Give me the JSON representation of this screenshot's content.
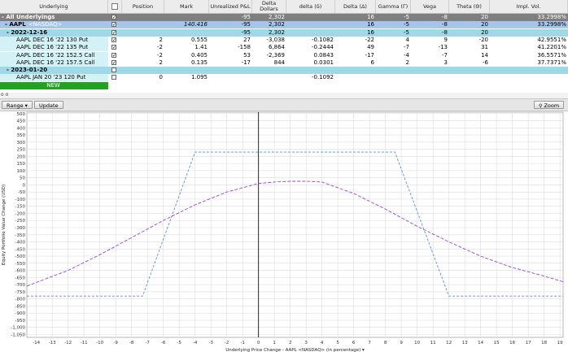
{
  "columns": [
    "Underlying",
    "",
    "Position",
    "Mark",
    "Unrealized P&L",
    "Delta Dollars",
    "delta (δ)",
    "Delta (Δ)",
    "Gamma (Γ)",
    "Vega",
    "Theta (Θ)",
    "Impl. Vol."
  ],
  "rows": [
    {
      "kind": "all",
      "name": "- All Underlyings",
      "checked": true,
      "position": "",
      "mark": "",
      "pnl": "-95",
      "delta_dollars": "2,302",
      "delta_small": "",
      "delta": "16",
      "gamma": "-5",
      "vega": "-8",
      "theta": "20",
      "iv": "33.2998%"
    },
    {
      "kind": "und",
      "name": "- AAPL",
      "exchange": "<NASDAQ>",
      "checked": true,
      "position": "",
      "mark": "140.416",
      "pnl": "-95",
      "delta_dollars": "2,302",
      "delta_small": "",
      "delta": "16",
      "gamma": "-5",
      "vega": "-8",
      "theta": "20",
      "iv": "33.2998%"
    },
    {
      "kind": "exp",
      "name": "- 2022-12-16",
      "checked": true,
      "position": "",
      "mark": "",
      "pnl": "-95",
      "delta_dollars": "2,302",
      "delta_small": "",
      "delta": "16",
      "gamma": "-5",
      "vega": "-8",
      "theta": "20",
      "iv": ""
    },
    {
      "kind": "leg",
      "name": "AAPL DEC 16 '22 130 Put",
      "checked": true,
      "position": "2",
      "mark": "0.555",
      "pnl": "27",
      "delta_dollars": "-3,038",
      "delta_small": "-0.1082",
      "delta": "-22",
      "gamma": "4",
      "vega": "9",
      "theta": "-20",
      "iv": "42.9551%"
    },
    {
      "kind": "leg",
      "name": "AAPL DEC 16 '22 135 Put",
      "checked": true,
      "position": "-2",
      "mark": "1.41",
      "pnl": "-158",
      "delta_dollars": "6,864",
      "delta_small": "-0.2444",
      "delta": "49",
      "gamma": "-7",
      "vega": "-13",
      "theta": "31",
      "iv": "41.2201%"
    },
    {
      "kind": "leg",
      "name": "AAPL DEC 16 '22 152.5 Call",
      "checked": true,
      "position": "-2",
      "mark": "0.405",
      "pnl": "53",
      "delta_dollars": "-2,369",
      "delta_small": "0.0843",
      "delta": "-17",
      "gamma": "-4",
      "vega": "-7",
      "theta": "14",
      "iv": "36.5571%"
    },
    {
      "kind": "leg",
      "name": "AAPL DEC 16 '22 157.5 Call",
      "checked": true,
      "position": "2",
      "mark": "0.135",
      "pnl": "-17",
      "delta_dollars": "844",
      "delta_small": "0.0301",
      "delta": "6",
      "gamma": "2",
      "vega": "3",
      "theta": "-6",
      "iv": "37.7371%"
    },
    {
      "kind": "exp",
      "name": "- 2023-01-20",
      "checked": false,
      "position": "",
      "mark": "",
      "pnl": "",
      "delta_dollars": "",
      "delta_small": "",
      "delta": "",
      "gamma": "",
      "vega": "",
      "theta": "",
      "iv": ""
    },
    {
      "kind": "leg2",
      "name": "AAPL JAN 20 '23 120 Put",
      "checked": false,
      "position": "0",
      "mark": "1.095",
      "pnl": "",
      "delta_dollars": "",
      "delta_small": "-0.1092",
      "delta": "",
      "gamma": "",
      "vega": "",
      "theta": "",
      "iv": ""
    },
    {
      "kind": "new",
      "name": "NEW",
      "checked": false
    }
  ],
  "toolbar": {
    "range_label": "Range ▾",
    "update_label": "Update",
    "zoom_label": "Zoom"
  },
  "colors": {
    "all_row": "#7f7f7f",
    "und_row": "#a8c4e8",
    "exp_row": "#9fd8e6",
    "leg_row": "#d4f2f5",
    "new_row": "#21a321",
    "line_expiry": "#5b8fd4",
    "line_today": "#9b3fe0"
  },
  "chart_data": {
    "type": "line",
    "xlabel": "Underlying Price Change - AAPL <NASDAQ> (in percentage) ▾",
    "ylabel": "Equity Portfolio Value Change (USD)",
    "xlim": [
      -14.6,
      19.2
    ],
    "ylim": [
      -1070,
      510
    ],
    "xticks": [
      -14,
      -13,
      -12,
      -11,
      -10,
      -9,
      -8,
      -7,
      -6,
      -5,
      -4,
      -3,
      -2,
      -1,
      0,
      1,
      2,
      3,
      4,
      5,
      6,
      7,
      8,
      9,
      10,
      11,
      12,
      13,
      14,
      15,
      16,
      17,
      18,
      19
    ],
    "yticks": [
      500,
      450,
      400,
      350,
      300,
      250,
      200,
      150,
      100,
      50,
      0,
      -50,
      -100,
      -150,
      -200,
      -250,
      -300,
      -350,
      -400,
      -450,
      -500,
      -550,
      -600,
      -650,
      -700,
      -750,
      -800,
      -850,
      -900,
      -950,
      -1000,
      -1050
    ],
    "series": [
      {
        "style": "dashed-blue",
        "x": [
          -14.6,
          -7.3,
          -4.0,
          8.6,
          12.0,
          19.2
        ],
        "y": [
          -780,
          -780,
          230,
          230,
          -780,
          -780
        ]
      },
      {
        "style": "dashed-purple",
        "x": [
          -14.6,
          -12,
          -10,
          -8,
          -6,
          -4,
          -2,
          0,
          1,
          2,
          3,
          4,
          6,
          8,
          10,
          12,
          14,
          16,
          18,
          19.2
        ],
        "y": [
          -710,
          -600,
          -490,
          -370,
          -250,
          -140,
          -50,
          10,
          20,
          25,
          25,
          20,
          -60,
          -170,
          -290,
          -400,
          -500,
          -580,
          -640,
          -680
        ]
      }
    ]
  }
}
